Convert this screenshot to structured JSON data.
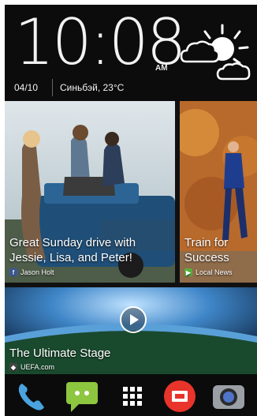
{
  "clock": {
    "time": "10:08",
    "ampm": "AM",
    "date": "04/10",
    "weather_summary": "Синьбэй, 23°C"
  },
  "weather": {
    "icon": "partly-sunny-icon"
  },
  "tiles": [
    {
      "headline": "Great Sunday drive with Jessie, Lisa, and Peter!",
      "source": "Jason Holt",
      "source_icon": "facebook-icon"
    },
    {
      "headline": "Train for Success",
      "source": "Local News",
      "source_icon": "local-news-icon"
    },
    {
      "headline": "The Ultimate Stage",
      "source": "UEFA.com",
      "source_icon": "uefa-icon"
    }
  ],
  "dock": [
    {
      "name": "phone",
      "icon": "phone-icon"
    },
    {
      "name": "messages",
      "icon": "messages-icon"
    },
    {
      "name": "all-apps",
      "icon": "app-grid-icon"
    },
    {
      "name": "mail",
      "icon": "mail-icon"
    },
    {
      "name": "camera",
      "icon": "camera-icon"
    }
  ],
  "colors": {
    "facebook": "#3b5998",
    "local_news": "#57b03c",
    "dock_green": "#8dc63f",
    "mail_red": "#e8342a"
  }
}
